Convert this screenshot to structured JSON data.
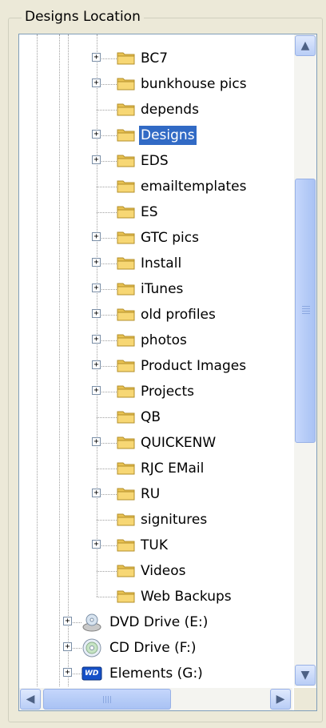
{
  "groupbox": {
    "title": "Designs Location"
  },
  "tree": {
    "folders": [
      {
        "label": "BC7",
        "expandable": true
      },
      {
        "label": "bunkhouse pics",
        "expandable": true
      },
      {
        "label": "depends",
        "expandable": false
      },
      {
        "label": "Designs",
        "expandable": true,
        "selected": true
      },
      {
        "label": "EDS",
        "expandable": true
      },
      {
        "label": "emailtemplates",
        "expandable": false
      },
      {
        "label": "ES",
        "expandable": false
      },
      {
        "label": "GTC pics",
        "expandable": true
      },
      {
        "label": "Install",
        "expandable": true
      },
      {
        "label": "iTunes",
        "expandable": true
      },
      {
        "label": "old profiles",
        "expandable": true
      },
      {
        "label": "photos",
        "expandable": true
      },
      {
        "label": "Product Images",
        "expandable": true
      },
      {
        "label": "Projects",
        "expandable": true
      },
      {
        "label": "QB",
        "expandable": false
      },
      {
        "label": "QUICKENW",
        "expandable": true
      },
      {
        "label": "RJC EMail",
        "expandable": false
      },
      {
        "label": "RU",
        "expandable": true
      },
      {
        "label": "signitures",
        "expandable": false
      },
      {
        "label": "TUK",
        "expandable": true
      },
      {
        "label": "Videos",
        "expandable": false
      },
      {
        "label": "Web Backups",
        "expandable": false
      }
    ],
    "drives": [
      {
        "label": "DVD Drive (E:)",
        "icon": "dvd-drive-icon"
      },
      {
        "label": "CD Drive (F:)",
        "icon": "cd-drive-icon"
      },
      {
        "label": "Elements (G:)",
        "icon": "wd-drive-icon",
        "badge": "WD"
      }
    ],
    "expander_symbol": "+"
  },
  "scrollbars": {
    "up_arrow": "▲",
    "down_arrow": "▼",
    "left_arrow": "◀",
    "right_arrow": "▶"
  },
  "colors": {
    "selection": "#316ac5",
    "folder": "#f7d774",
    "scroll_thumb": "#b6ccf7"
  }
}
